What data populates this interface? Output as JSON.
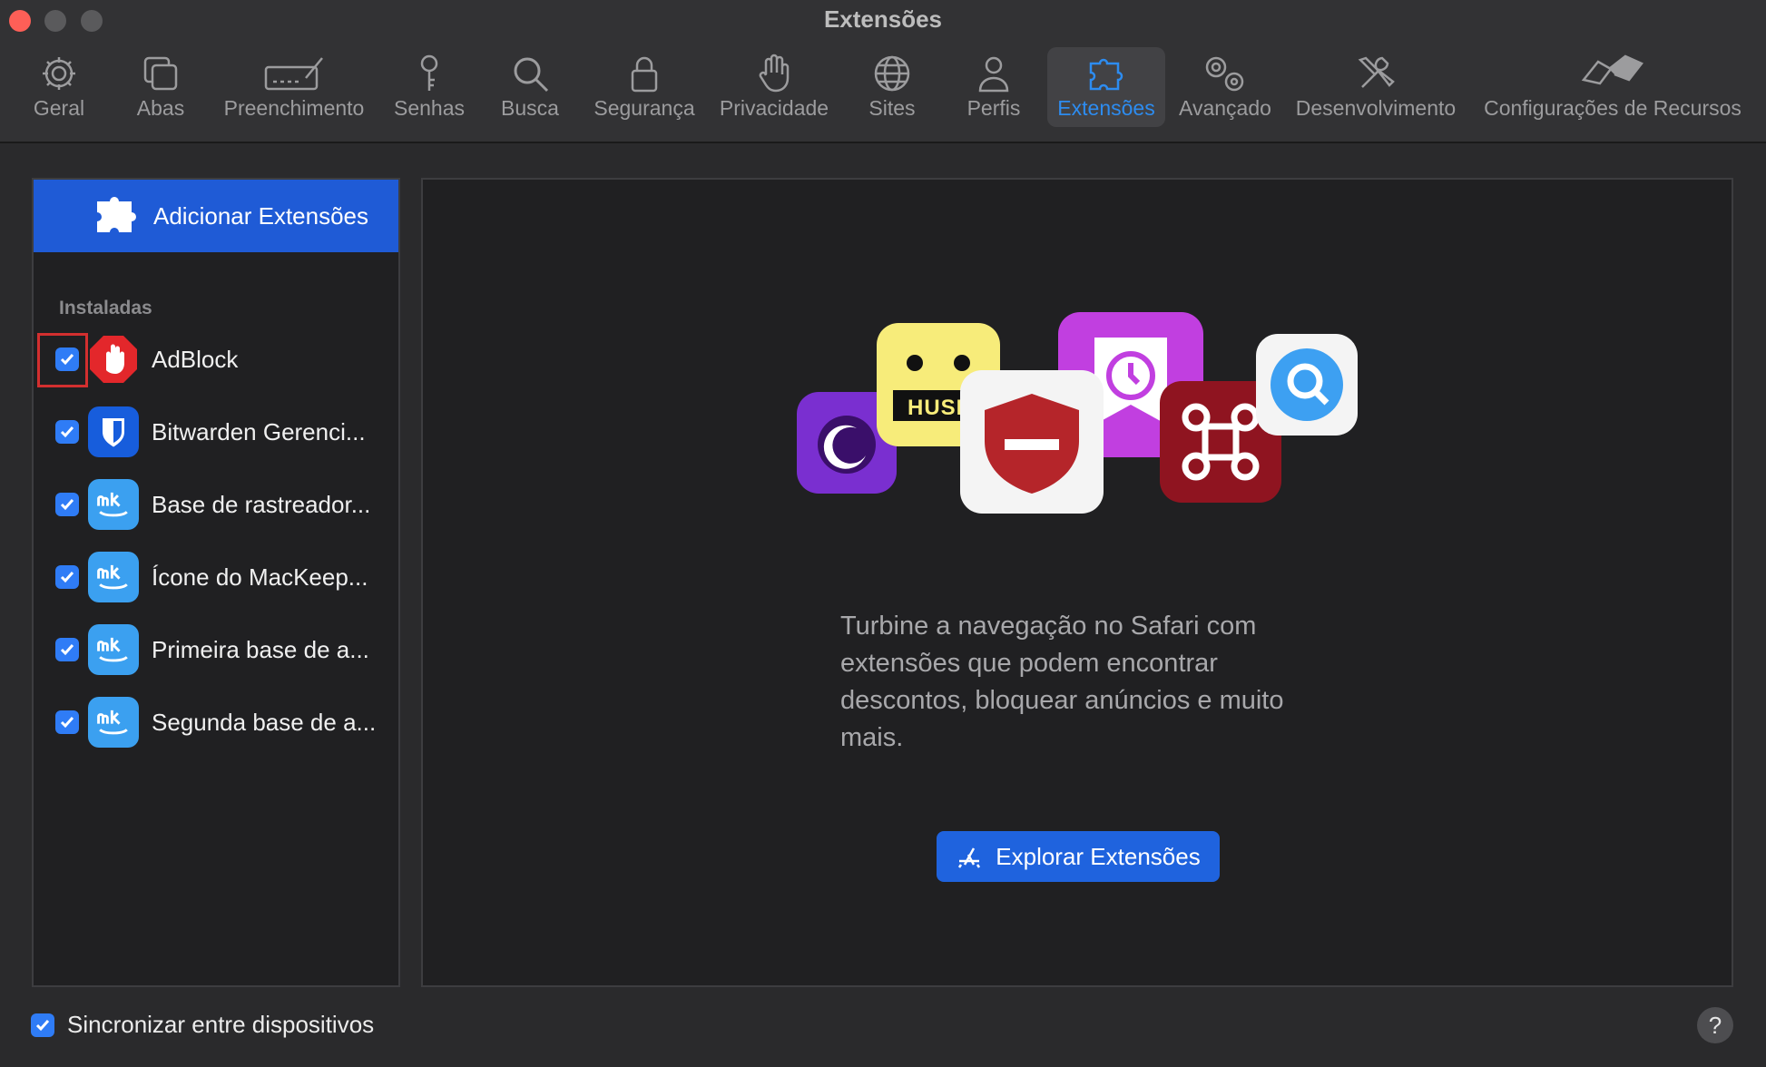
{
  "window": {
    "title": "Extensões"
  },
  "toolbar": {
    "items": [
      {
        "label": "Geral",
        "icon": "gear-icon"
      },
      {
        "label": "Abas",
        "icon": "tabs-icon"
      },
      {
        "label": "Preenchimento",
        "icon": "autofill-icon"
      },
      {
        "label": "Senhas",
        "icon": "key-icon"
      },
      {
        "label": "Busca",
        "icon": "search-icon"
      },
      {
        "label": "Segurança",
        "icon": "lock-icon"
      },
      {
        "label": "Privacidade",
        "icon": "hand-icon"
      },
      {
        "label": "Sites",
        "icon": "globe-icon"
      },
      {
        "label": "Perfis",
        "icon": "person-icon"
      },
      {
        "label": "Extensões",
        "icon": "puzzle-icon",
        "active": true
      },
      {
        "label": "Avançado",
        "icon": "gears-icon"
      },
      {
        "label": "Desenvolvimento",
        "icon": "tools-icon"
      },
      {
        "label": "Configurações de Recursos",
        "icon": "flags-icon"
      }
    ],
    "active_color": "#2d8cf0"
  },
  "sidebar": {
    "add_label": "Adicionar Extensões",
    "section_label": "Instaladas",
    "extensions": [
      {
        "name": "AdBlock",
        "checked": true,
        "icon": "adblock-icon"
      },
      {
        "name": "Bitwarden Gerenci...",
        "checked": true,
        "icon": "bitwarden-icon"
      },
      {
        "name": "Base de rastreador...",
        "checked": true,
        "icon": "mackeeper-icon"
      },
      {
        "name": "Ícone do MacKeep...",
        "checked": true,
        "icon": "mackeeper-icon"
      },
      {
        "name": "Primeira base de a...",
        "checked": true,
        "icon": "mackeeper-icon"
      },
      {
        "name": "Segunda base de a...",
        "checked": true,
        "icon": "mackeeper-icon"
      }
    ]
  },
  "main": {
    "promo_text": "Turbine a navegação no Safari com extensões que podem encontrar descontos, bloquear anúncios e muito mais.",
    "explore_label": "Explorar Extensões",
    "hush_label": "HUSH"
  },
  "footer": {
    "sync_label": "Sincronizar entre dispositivos",
    "sync_checked": true,
    "help_label": "?"
  },
  "colors": {
    "accent": "#1f5bd6",
    "checkbox": "#2f7cf6",
    "highlight_box": "#d32f2f"
  }
}
